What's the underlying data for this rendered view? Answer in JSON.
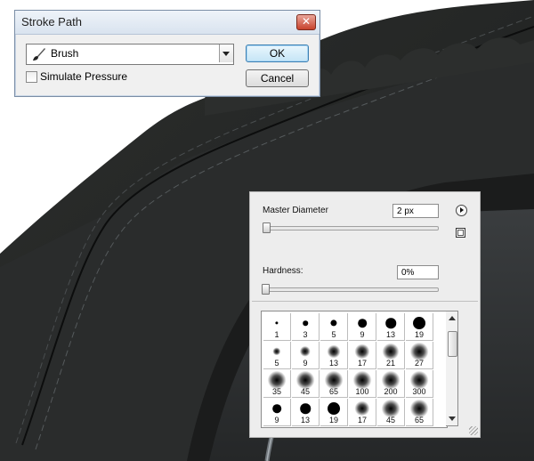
{
  "dialog": {
    "title": "Stroke Path",
    "close_glyph": "✕",
    "tool_select_value": "Brush",
    "tool_icon": "brush-icon",
    "simulate_pressure_label": "Simulate Pressure",
    "simulate_pressure_checked": false,
    "ok_label": "OK",
    "cancel_label": "Cancel"
  },
  "brush_panel": {
    "master_diameter_label": "Master Diameter",
    "master_diameter_value": "2 px",
    "hardness_label": "Hardness:",
    "hardness_value": "0%",
    "menu_icon": "flyout-menu-icon",
    "save_icon": "new-preset-icon",
    "presets": [
      {
        "label": "1",
        "hard": true
      },
      {
        "label": "3",
        "hard": true
      },
      {
        "label": "5",
        "hard": true
      },
      {
        "label": "9",
        "hard": true
      },
      {
        "label": "13",
        "hard": true
      },
      {
        "label": "19",
        "hard": true
      },
      {
        "label": "5",
        "hard": false
      },
      {
        "label": "9",
        "hard": false
      },
      {
        "label": "13",
        "hard": false
      },
      {
        "label": "17",
        "hard": false
      },
      {
        "label": "21",
        "hard": false
      },
      {
        "label": "27",
        "hard": false
      },
      {
        "label": "35",
        "hard": false
      },
      {
        "label": "45",
        "hard": false
      },
      {
        "label": "65",
        "hard": false
      },
      {
        "label": "100",
        "hard": false
      },
      {
        "label": "200",
        "hard": false
      },
      {
        "label": "300",
        "hard": false
      },
      {
        "label": "9",
        "hard": true
      },
      {
        "label": "13",
        "hard": true
      },
      {
        "label": "19",
        "hard": true
      },
      {
        "label": "17",
        "hard": false
      },
      {
        "label": "45",
        "hard": false
      },
      {
        "label": "65",
        "hard": false
      }
    ]
  },
  "colors": {
    "canvas_dark": "#262827",
    "dialog_bg": "#f0f0f0",
    "panel_bg": "#ededed"
  }
}
